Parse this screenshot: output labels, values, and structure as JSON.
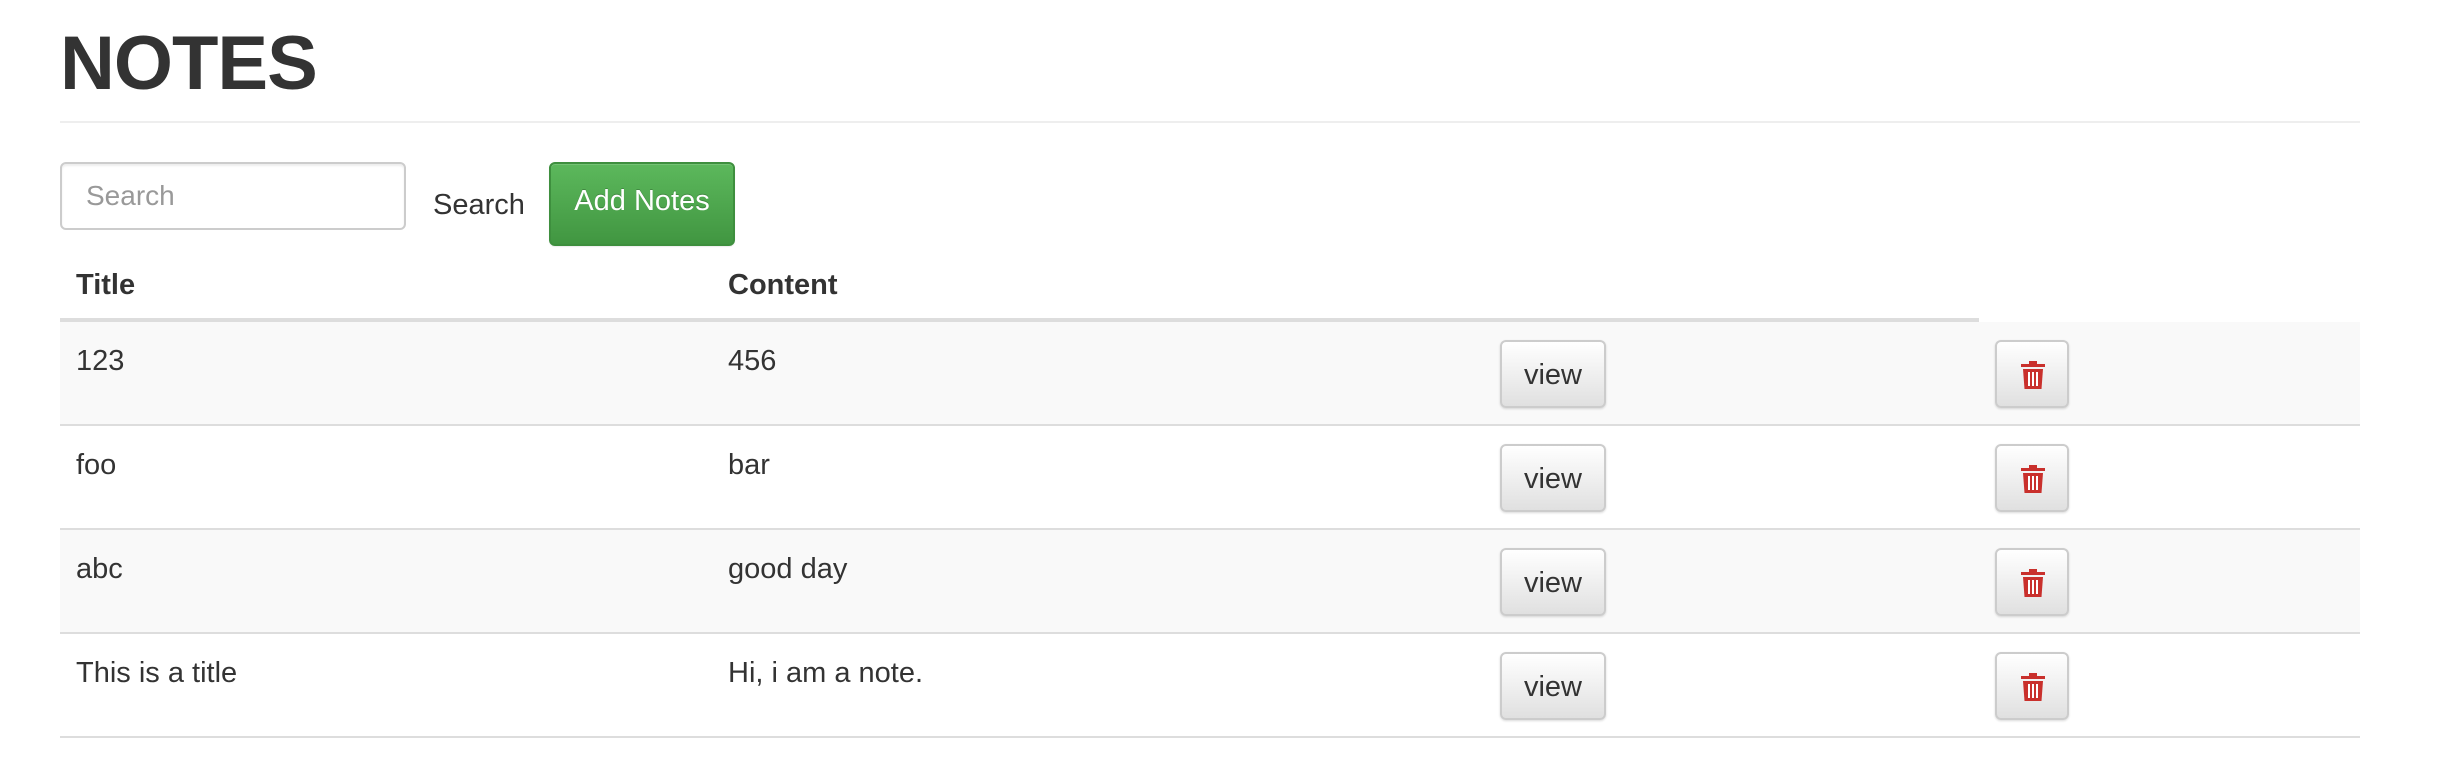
{
  "header": {
    "title": "NOTES"
  },
  "toolbar": {
    "search_placeholder": "Search",
    "search_value": "",
    "search_label": "Search",
    "add_label": "Add Notes"
  },
  "table": {
    "columns": [
      "Title",
      "Content"
    ],
    "rows": [
      {
        "title": "123",
        "content": "456",
        "view_label": "view",
        "delete_icon": "trash-icon"
      },
      {
        "title": "foo",
        "content": "bar",
        "view_label": "view",
        "delete_icon": "trash-icon"
      },
      {
        "title": "abc",
        "content": "good day",
        "view_label": "view",
        "delete_icon": "trash-icon"
      },
      {
        "title": "This is a title",
        "content": "Hi, i am a note.",
        "view_label": "view",
        "delete_icon": "trash-icon"
      }
    ]
  },
  "colors": {
    "add_button": "#5cb85c",
    "trash_icon": "#c9302c",
    "stripe": "#f9f9f9",
    "border": "#dddddd"
  }
}
